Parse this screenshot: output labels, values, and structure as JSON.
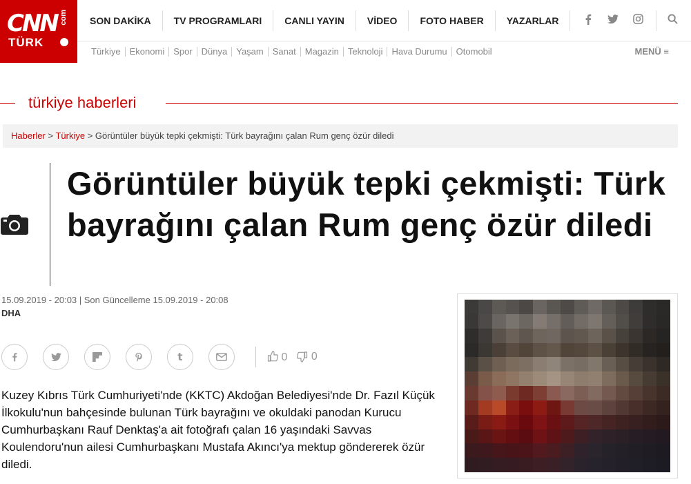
{
  "logo": {
    "main": "CNN",
    "sub": "TÜRK",
    "com": "com"
  },
  "topnav": {
    "items": [
      "SON DAKİKA",
      "TV PROGRAMLARI",
      "CANLI YAYIN",
      "VİDEO",
      "FOTO HABER",
      "YAZARLAR"
    ],
    "social_icons": [
      "facebook-icon",
      "twitter-icon",
      "instagram-icon"
    ],
    "search_icon": "search-icon"
  },
  "subnav": {
    "items": [
      "Türkiye",
      "Ekonomi",
      "Spor",
      "Dünya",
      "Yaşam",
      "Sanat",
      "Magazin",
      "Teknoloji",
      "Hava Durumu",
      "Otomobil"
    ],
    "menu_label": "MENÜ ≡"
  },
  "section_title": "türkiye haberleri",
  "breadcrumb": {
    "items": [
      "Haberler",
      "Türkiye"
    ],
    "current": "Görüntüler büyük tepki çekmişti: Türk bayrağını çalan Rum genç özür diledi"
  },
  "article": {
    "headline": "Görüntüler büyük tepki çekmişti: Türk bayrağını çalan Rum genç özür diledi",
    "meta": "15.09.2019 - 20:03 | Son Güncelleme 15.09.2019 - 20:08",
    "source": "DHA",
    "likes": "0",
    "dislikes": "0",
    "body": "Kuzey Kıbrıs Türk Cumhuriyeti'nde (KKTC) Akdoğan Belediyesi'nde Dr. Fazıl Küçük İlkokulu'nun bahçesinde bulunan Türk bayrağını ve okuldaki panodan Kurucu Cumhurbaşkanı Rauf Denktaş'a ait fotoğrafı çalan 16 yaşındaki Savvas Koulendoru'nun ailesi Cumhurbaşkanı Mustafa Akıncı'ya mektup göndererek özür diledi."
  },
  "share_icons": [
    "facebook-icon",
    "twitter-icon",
    "flipboard-icon",
    "pinterest-icon",
    "tumblr-icon",
    "mail-icon"
  ],
  "colors": {
    "brand": "#cc0000",
    "text": "#111111",
    "muted": "#888888"
  }
}
